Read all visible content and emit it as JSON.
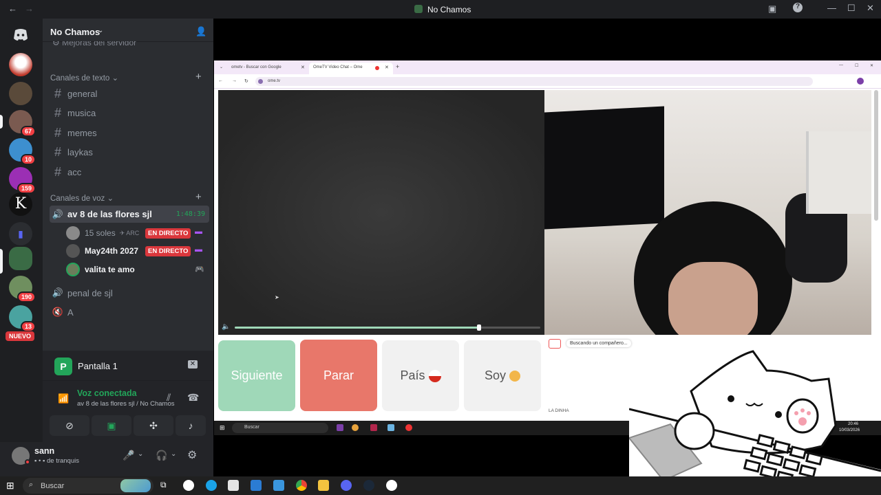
{
  "window": {
    "title": "No Chamos"
  },
  "server": {
    "name": "No Chamos",
    "truncated_item": "Mejoras del servidor"
  },
  "servers": [
    {
      "badge": ""
    },
    {
      "badge": ""
    },
    {
      "badge": "67"
    },
    {
      "badge": "10"
    },
    {
      "badge": "159"
    },
    {
      "badge": ""
    },
    {
      "badge": ""
    },
    {
      "badge": ""
    },
    {
      "badge": "190"
    },
    {
      "badge": "13"
    }
  ],
  "new_label": "NUEVO",
  "text_category": "Canales de texto",
  "text_channels": [
    "general",
    "musica",
    "memes",
    "laykas",
    "acc"
  ],
  "voice_category": "Canales de voz",
  "voice_channels": {
    "active": {
      "name": "av 8 de las flores sjl",
      "timer": "1:48:39"
    },
    "users": [
      {
        "name": "15 soles",
        "status": "ARC",
        "live": "EN DIRECTO"
      },
      {
        "name": "May24th 2027",
        "live": "EN DIRECTO"
      },
      {
        "name": "valita te amo"
      }
    ],
    "others": [
      "penal de sjl",
      "A"
    ]
  },
  "stream": {
    "title": "Pantalla 1"
  },
  "voice_status": {
    "label": "Voz conectada",
    "detail": "av 8 de las flores sjl / No Chamos"
  },
  "user": {
    "name": "sann",
    "status": "de tranquis"
  },
  "browser": {
    "tab1": "ometv - Buscar con Google",
    "tab2": "OmeTV Video Chat – Ome",
    "url": "ome.tv"
  },
  "ometv": {
    "next": "Siguiente",
    "stop": "Parar",
    "country": "País",
    "gender": "Soy",
    "searching": "Buscando un compañero...",
    "brand": "LA DINHA",
    "volume": 0.8
  },
  "inner_taskbar": {
    "search": "Buscar",
    "time": "20:46",
    "date": "10/03/2026"
  },
  "taskbar": {
    "search": "Buscar"
  },
  "colors": {
    "accent": "#5865f2",
    "live": "#da373c",
    "green": "#23a55a",
    "next": "#9fd8b8",
    "stop": "#e8776a"
  }
}
